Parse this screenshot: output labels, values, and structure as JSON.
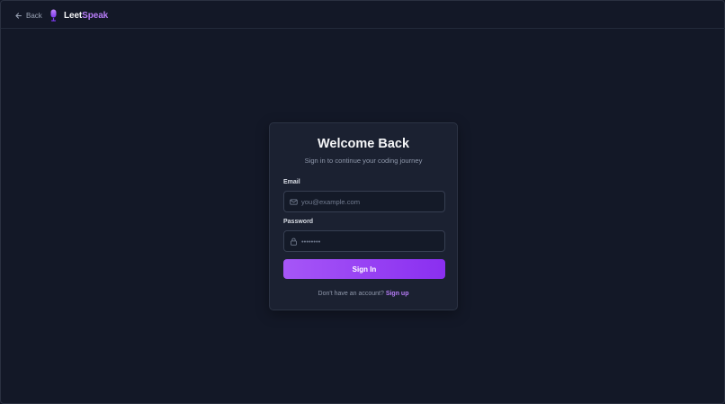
{
  "header": {
    "back_label": "Back",
    "brand_part1": "Leet",
    "brand_part2": "Speak"
  },
  "login": {
    "title": "Welcome Back",
    "subtitle": "Sign in to continue your coding journey",
    "email_label": "Email",
    "email_placeholder": "you@example.com",
    "password_label": "Password",
    "password_placeholder": "••••••••",
    "submit_label": "Sign In",
    "footer_text": "Don't have an account?",
    "signup_label": "Sign up"
  },
  "colors": {
    "background": "#131827",
    "card": "#1b2131",
    "accent": "#a656f7",
    "accent_dark": "#8a2ff0",
    "brand_accent": "#b67cf6"
  },
  "icons": {
    "back": "arrow-left-icon",
    "logo": "microphone-icon",
    "email": "mail-icon",
    "password": "lock-icon"
  }
}
